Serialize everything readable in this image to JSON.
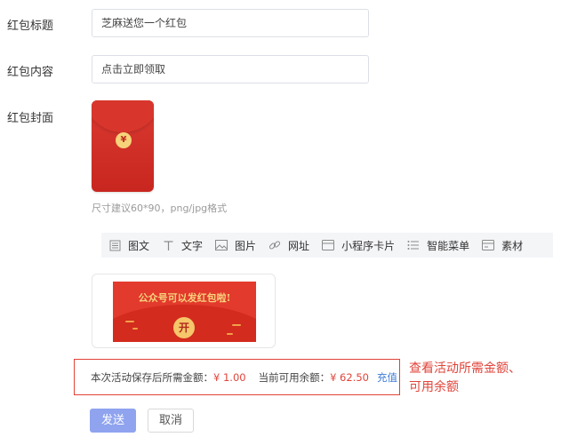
{
  "form": {
    "title_label": "红包标题",
    "title_value": "芝麻送您一个红包",
    "content_label": "红包内容",
    "content_value": "点击立即领取",
    "cover_label": "红包封面",
    "cover_coin": "¥",
    "cover_hint": "尺寸建议60*90，png/jpg格式"
  },
  "toolbar": {
    "items": [
      {
        "label": "图文",
        "icon": "article-icon"
      },
      {
        "label": "文字",
        "icon": "text-icon"
      },
      {
        "label": "图片",
        "icon": "image-icon"
      },
      {
        "label": "网址",
        "icon": "link-icon"
      },
      {
        "label": "小程序卡片",
        "icon": "mini-program-card-icon"
      },
      {
        "label": "智能菜单",
        "icon": "menu-list-icon"
      },
      {
        "label": "素材",
        "icon": "material-icon"
      }
    ]
  },
  "preview": {
    "banner_text": "公众号可以发红包啦!",
    "open_label": "开"
  },
  "fee": {
    "required_label": "本次活动保存后所需金额：",
    "required_value": "¥ 1.00",
    "available_label": "当前可用余额：",
    "available_value": "¥ 62.50",
    "recharge_label": "充值"
  },
  "annotation": {
    "text": "查看活动所需金额、\n可用余额"
  },
  "actions": {
    "send_label": "发送",
    "cancel_label": "取消"
  },
  "colors": {
    "accent_red": "#e0443a",
    "link_blue": "#3d7ad6",
    "primary_button": "#8fa3ef"
  }
}
